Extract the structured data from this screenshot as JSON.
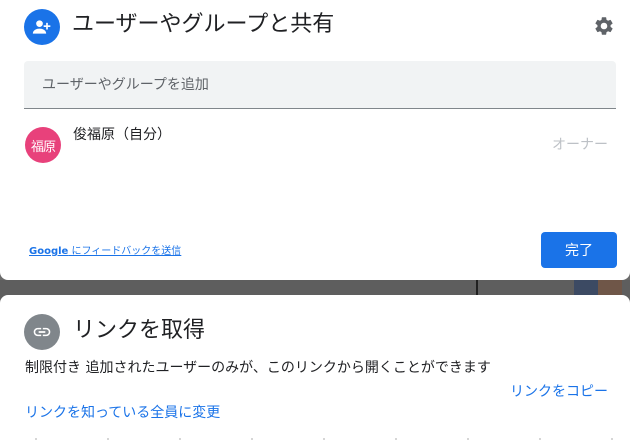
{
  "share": {
    "title": "ユーザーやグループと共有",
    "add_placeholder": "ユーザーやグループを追加",
    "owner": {
      "avatar_text": "福原",
      "name": "俊福原（自分）",
      "role": "オーナー"
    },
    "feedback_prefix": "Google",
    "feedback_text": " にフィードバックを送信",
    "done_label": "完了"
  },
  "link": {
    "title": "リンクを取得",
    "description": "制限付き 追加されたユーザーのみが、このリンクから開くことができます",
    "change_label": "リンクを知っている全員に変更",
    "copy_label": "リンクをコピー"
  },
  "colors": {
    "accent": "#1a73e8",
    "avatar": "#e8417b",
    "link_icon_bg": "#80868b"
  },
  "icons": {
    "share_header": "person-add-icon",
    "settings": "gear-icon",
    "link": "link-icon"
  }
}
